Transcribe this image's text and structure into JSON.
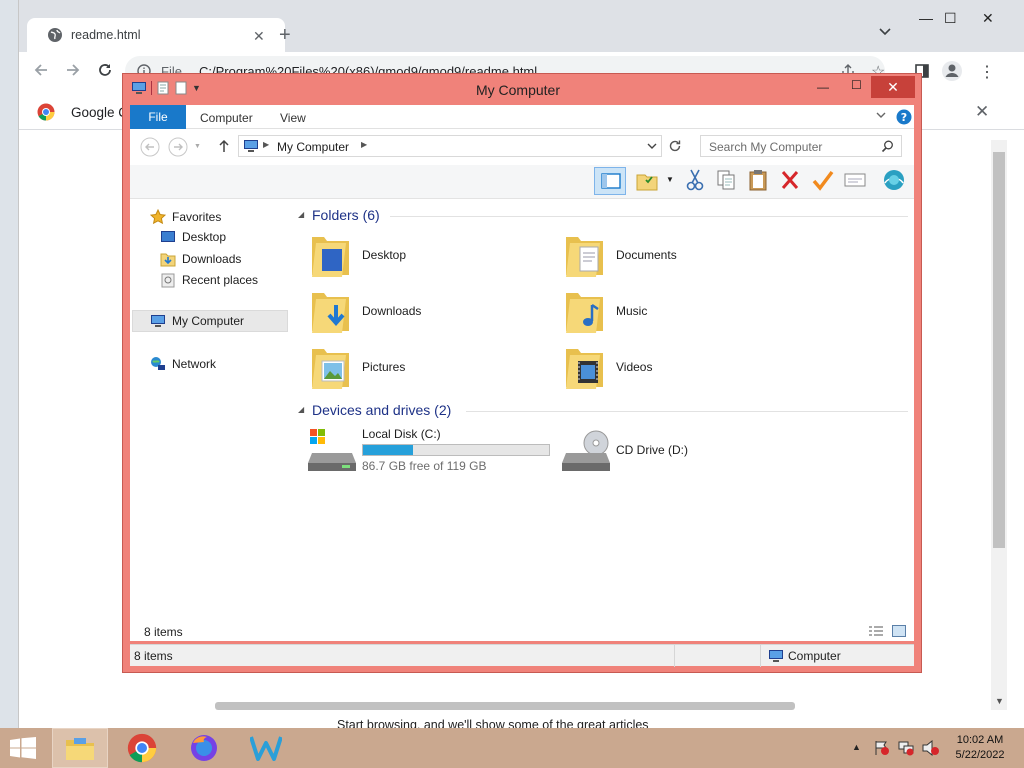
{
  "browser": {
    "tab_title": "readme.html",
    "url_scheme": "File",
    "url": "C:/Program%20Files%20(x86)/qmod9/qmod9/readme.html",
    "banner_title": "Google C",
    "bottom_text": "Start browsing, and we'll show some of the great articles"
  },
  "explorer": {
    "title": "My Computer",
    "ribbon_tabs": {
      "file": "File",
      "computer": "Computer",
      "view": "View"
    },
    "address": "My Computer",
    "search_placeholder": "Search My Computer",
    "nav": {
      "favorites": "Favorites",
      "desktop": "Desktop",
      "downloads": "Downloads",
      "recent": "Recent places",
      "mycomputer": "My Computer",
      "network": "Network"
    },
    "folders_header": "Folders (6)",
    "folders": [
      "Desktop",
      "Documents",
      "Downloads",
      "Music",
      "Pictures",
      "Videos"
    ],
    "devices_header": "Devices and drives (2)",
    "drives": {
      "c_name": "Local Disk (C:)",
      "c_free": "86.7 GB free of 119 GB",
      "c_used_fraction": 0.271,
      "d_name": "CD Drive (D:)"
    },
    "items_count": "8 items",
    "status_items": "8 items",
    "status_location": "Computer"
  },
  "taskbar": {
    "time": "10:02 AM",
    "date": "5/22/2022"
  },
  "colors": {
    "window_frame": "#f0827a",
    "ribbon_file": "#1979ca",
    "taskbar": "#caa88f",
    "progress": "#26a0da"
  }
}
